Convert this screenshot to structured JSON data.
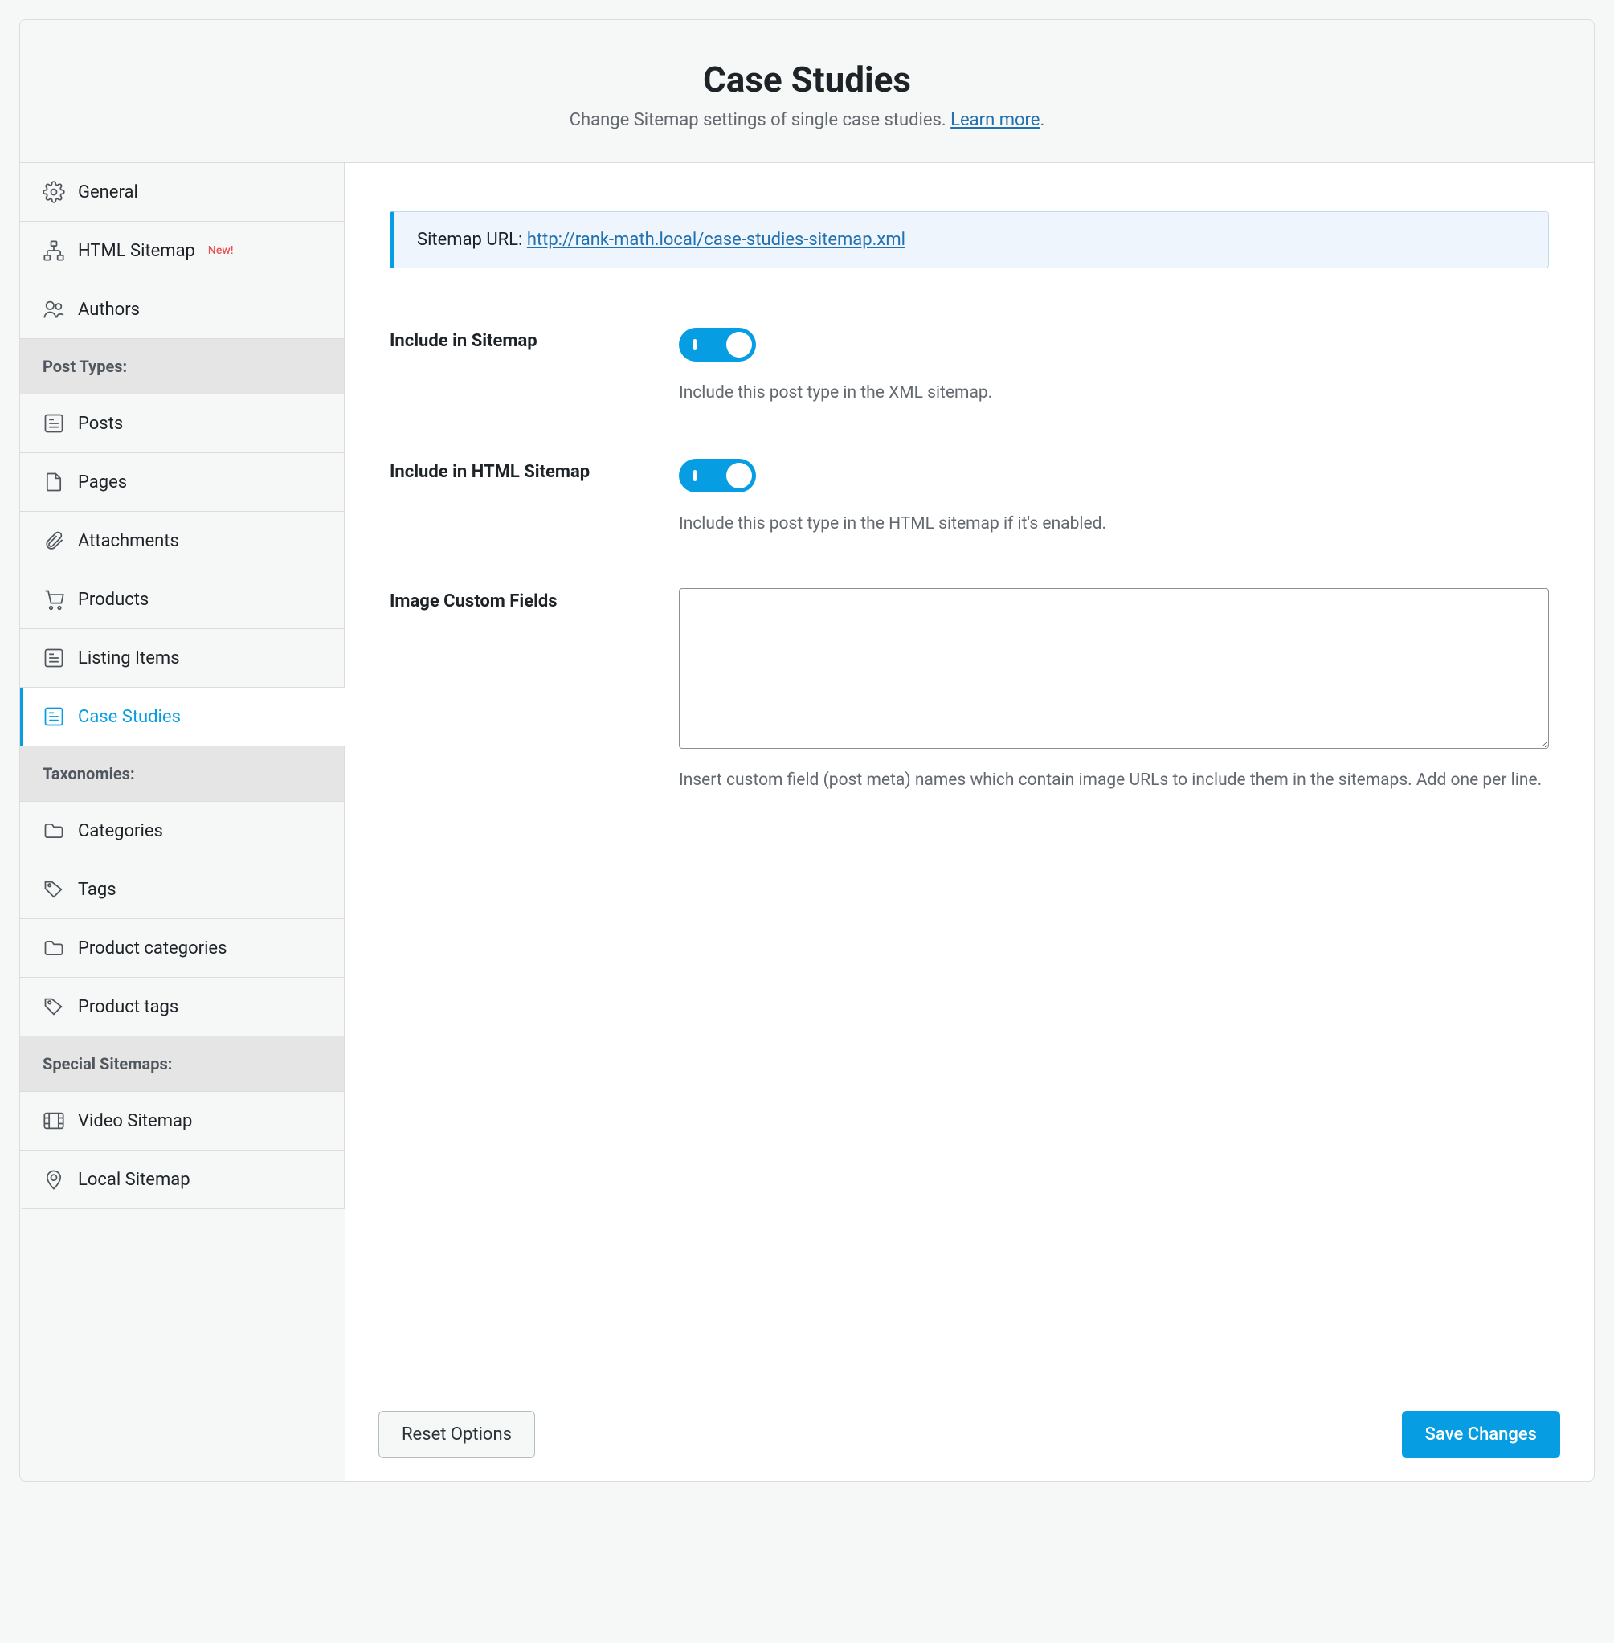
{
  "header": {
    "title": "Case Studies",
    "subtitle_prefix": "Change Sitemap settings of single case studies. ",
    "learn_more": "Learn more",
    "subtitle_suffix": "."
  },
  "sidebar": {
    "items": [
      {
        "label": "General",
        "icon": "gear"
      },
      {
        "label": "HTML Sitemap",
        "icon": "sitemap",
        "badge": "New!"
      },
      {
        "label": "Authors",
        "icon": "users"
      }
    ],
    "post_types_heading": "Post Types:",
    "post_types": [
      {
        "label": "Posts",
        "icon": "post"
      },
      {
        "label": "Pages",
        "icon": "page"
      },
      {
        "label": "Attachments",
        "icon": "paperclip"
      },
      {
        "label": "Products",
        "icon": "cart"
      },
      {
        "label": "Listing Items",
        "icon": "post"
      },
      {
        "label": "Case Studies",
        "icon": "post",
        "active": true
      }
    ],
    "taxonomies_heading": "Taxonomies:",
    "taxonomies": [
      {
        "label": "Categories",
        "icon": "folder"
      },
      {
        "label": "Tags",
        "icon": "tag"
      },
      {
        "label": "Product categories",
        "icon": "folder"
      },
      {
        "label": "Product tags",
        "icon": "tag"
      }
    ],
    "special_heading": "Special Sitemaps:",
    "special": [
      {
        "label": "Video Sitemap",
        "icon": "video"
      },
      {
        "label": "Local Sitemap",
        "icon": "pin"
      }
    ]
  },
  "notice": {
    "prefix": "Sitemap URL: ",
    "url": "http://rank-math.local/case-studies-sitemap.xml"
  },
  "fields": {
    "include_sitemap": {
      "label": "Include in Sitemap",
      "help": "Include this post type in the XML sitemap."
    },
    "include_html": {
      "label": "Include in HTML Sitemap",
      "help": "Include this post type in the HTML sitemap if it's enabled."
    },
    "image_custom": {
      "label": "Image Custom Fields",
      "value": "",
      "help": "Insert custom field (post meta) names which contain image URLs to include them in the sitemaps. Add one per line."
    }
  },
  "footer": {
    "reset": "Reset Options",
    "save": "Save Changes"
  }
}
